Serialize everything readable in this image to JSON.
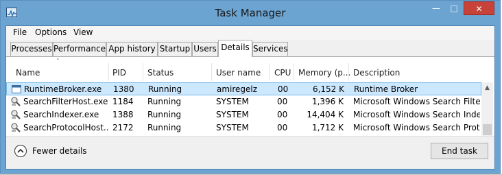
{
  "window": {
    "title": "Task Manager",
    "minimize_glyph": "—",
    "maximize_glyph": "□",
    "close_glyph": "✕",
    "colors": {
      "frame": "#6ba3d1",
      "close": "#c7433a",
      "selected_row": "#cce8ff"
    }
  },
  "menu": {
    "file": "File",
    "options": "Options",
    "view": "View"
  },
  "tabs": [
    {
      "label": "Processes"
    },
    {
      "label": "Performance"
    },
    {
      "label": "App history"
    },
    {
      "label": "Startup"
    },
    {
      "label": "Users"
    },
    {
      "label": "Details",
      "active": true
    },
    {
      "label": "Services"
    }
  ],
  "table": {
    "sort_glyph": "˄",
    "columns": {
      "name": "Name",
      "pid": "PID",
      "status": "Status",
      "user": "User name",
      "cpu": "CPU",
      "memory": "Memory (p...",
      "description": "Description"
    },
    "rows": [
      {
        "name": "RuntimeBroker.exe",
        "pid": "1380",
        "status": "Running",
        "user": "amiregelz",
        "cpu": "00",
        "memory": "6,152 K",
        "description": "Runtime Broker",
        "icon": "app-window-icon",
        "selected": true
      },
      {
        "name": "SearchFilterHost.exe",
        "pid": "1184",
        "status": "Running",
        "user": "SYSTEM",
        "cpu": "00",
        "memory": "1,396 K",
        "description": "Microsoft Windows Search Filter...",
        "icon": "search-process-icon"
      },
      {
        "name": "SearchIndexer.exe",
        "pid": "1388",
        "status": "Running",
        "user": "SYSTEM",
        "cpu": "00",
        "memory": "14,404 K",
        "description": "Microsoft Windows Search Inde...",
        "icon": "search-process-icon"
      },
      {
        "name": "SearchProtocolHost....",
        "pid": "2172",
        "status": "Running",
        "user": "SYSTEM",
        "cpu": "00",
        "memory": "1,712 K",
        "description": "Microsoft Windows Search Prot...",
        "icon": "search-process-icon"
      }
    ],
    "scroll_up_glyph": "▲",
    "scroll_down_glyph": "▼"
  },
  "footer": {
    "fewer_details": "Fewer details",
    "end_task": "End task"
  }
}
